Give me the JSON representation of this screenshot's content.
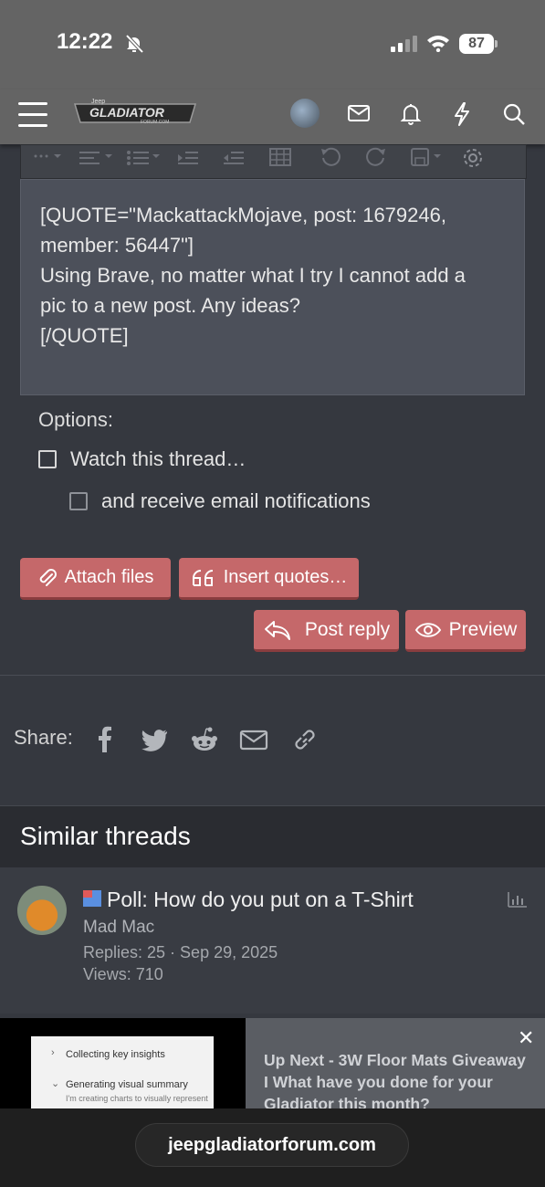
{
  "status_bar": {
    "time": "12:22",
    "battery": "87"
  },
  "header": {
    "logo_text": "GLADIATOR",
    "logo_sub": "FORUM.COM",
    "logo_badge": "Jeep"
  },
  "editor": {
    "lines": [
      "[QUOTE=\"MackattackMojave, post: 1679246,",
      "member: 56447\"]",
      "Using Brave, no matter what I try I cannot add a",
      "pic to a new post. Any ideas?",
      "[/QUOTE]"
    ]
  },
  "options": {
    "label": "Options:",
    "watch_label": "Watch this thread…",
    "email_label": "and receive email notifications"
  },
  "buttons": {
    "attach": "Attach files",
    "insert_quotes": "Insert quotes…",
    "post_reply": "Post reply",
    "preview": "Preview"
  },
  "share": {
    "label": "Share:"
  },
  "similar": {
    "heading": "Similar threads",
    "threads": [
      {
        "title": "Poll: How do you put on a T-Shirt",
        "author": "Mad Mac",
        "meta": "Replies: 25 · Sep 29, 2025",
        "views": "Views: 710"
      }
    ]
  },
  "ad": {
    "line1": "Collecting key insights",
    "line2": "Generating visual summary",
    "line3": "I'm creating charts to visually represent",
    "headline": "Up Next - 3W Floor Mats Giveaway I What have you done for your Gladiator this month?"
  },
  "browser": {
    "url": "jeepgladiatorforum.com"
  },
  "colors": {
    "accent_button": "#c5686a",
    "page_bg": "#35383f",
    "header_bg": "#646464"
  }
}
